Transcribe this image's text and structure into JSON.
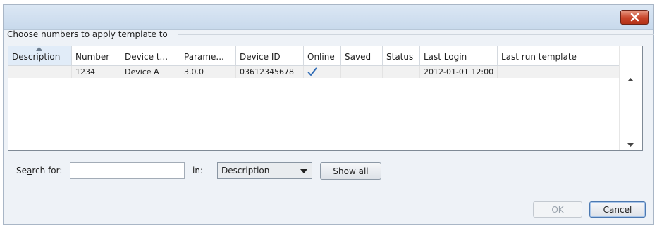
{
  "dialog": {
    "group_label": "Choose numbers to apply template to",
    "close_icon": "close-x-icon",
    "accent_close": "#c8452a"
  },
  "table": {
    "columns": [
      {
        "label": "Description",
        "sorted": true
      },
      {
        "label": "Number"
      },
      {
        "label": "Device t..."
      },
      {
        "label": "Parame..."
      },
      {
        "label": "Device ID"
      },
      {
        "label": "Online"
      },
      {
        "label": "Saved"
      },
      {
        "label": "Status"
      },
      {
        "label": "Last Login"
      },
      {
        "label": "Last run template"
      }
    ],
    "rows": [
      {
        "description": "",
        "number": "1234",
        "device_type": "Device A",
        "parameters": "3.0.0",
        "device_id": "03612345678",
        "online": "check-icon",
        "saved": "",
        "status": "",
        "last_login": "2012-01-01 12:00",
        "last_run_template": ""
      }
    ]
  },
  "search": {
    "label_pre": "Se",
    "label_key": "a",
    "label_post": "rch for:",
    "value": "",
    "in_label": "in:",
    "selected_field": "Description",
    "show_all_pre": "Sho",
    "show_all_key": "w",
    "show_all_post": " all"
  },
  "footer": {
    "ok_label": "OK",
    "cancel_label": "Cancel"
  }
}
